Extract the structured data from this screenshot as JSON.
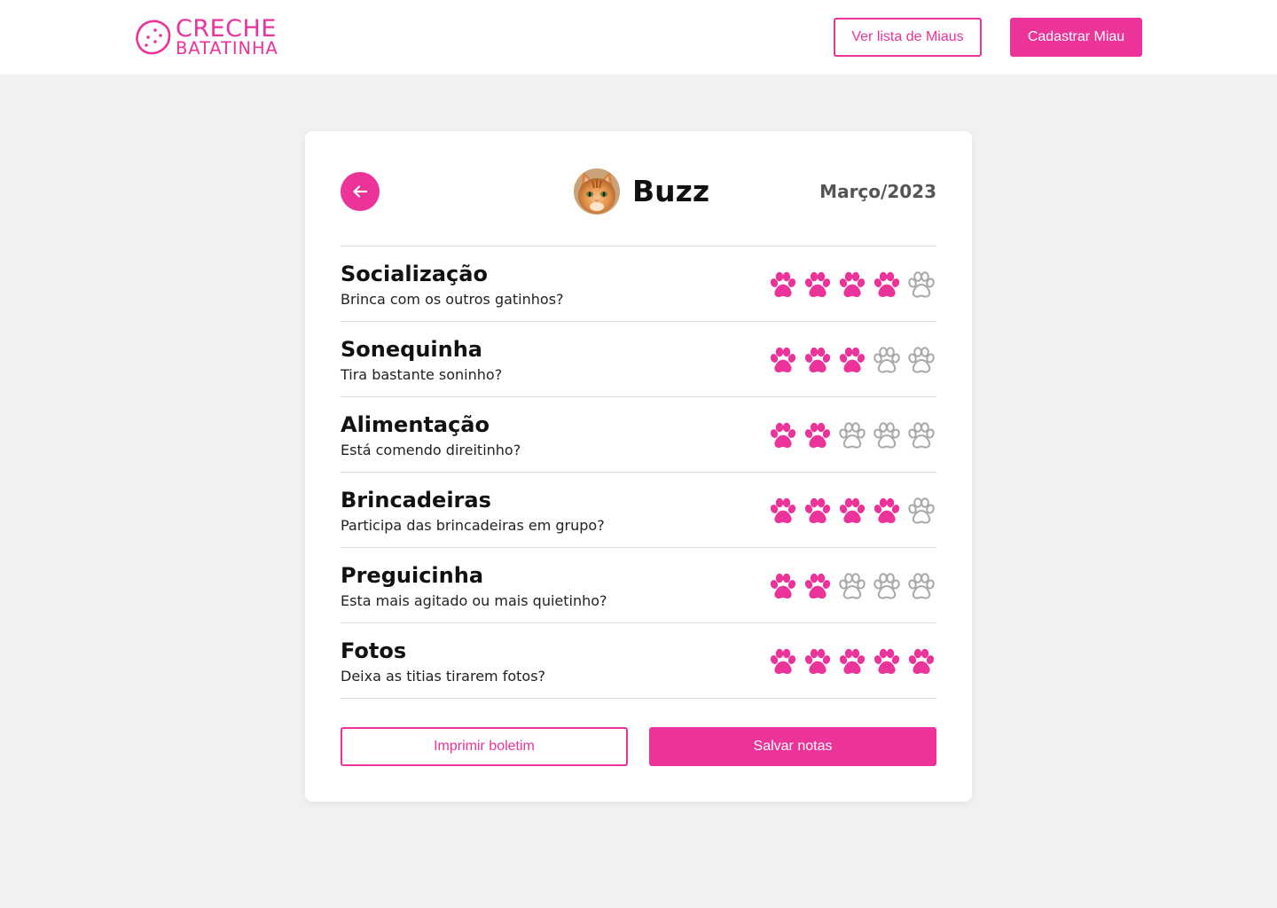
{
  "header": {
    "logo_line1": "CRECHE",
    "logo_line2": "BATATINHA",
    "list_button": "Ver lista de Miaus",
    "register_button": "Cadastrar Miau"
  },
  "report": {
    "cat_name": "Buzz",
    "month": "Março/2023",
    "max_rating": 5,
    "categories": [
      {
        "title": "Socialização",
        "question": "Brinca com os outros gatinhos?",
        "rating": 4
      },
      {
        "title": "Sonequinha",
        "question": "Tira bastante soninho?",
        "rating": 3
      },
      {
        "title": "Alimentação",
        "question": "Está comendo direitinho?",
        "rating": 2
      },
      {
        "title": "Brincadeiras",
        "question": "Participa das brincadeiras em grupo?",
        "rating": 4
      },
      {
        "title": "Preguicinha",
        "question": "Esta mais agitado ou mais quietinho?",
        "rating": 2
      },
      {
        "title": "Fotos",
        "question": "Deixa as titias tirarem fotos?",
        "rating": 5
      }
    ],
    "print_button": "Imprimir boletim",
    "save_button": "Salvar notas"
  },
  "colors": {
    "accent": "#ec3399",
    "paw_empty": "#a8a8a8",
    "background": "#f1f1f1"
  },
  "icons": {
    "logo": "potato-icon",
    "back": "arrow-left-icon",
    "rating_filled": "paw-filled-icon",
    "rating_empty": "paw-outline-icon"
  }
}
